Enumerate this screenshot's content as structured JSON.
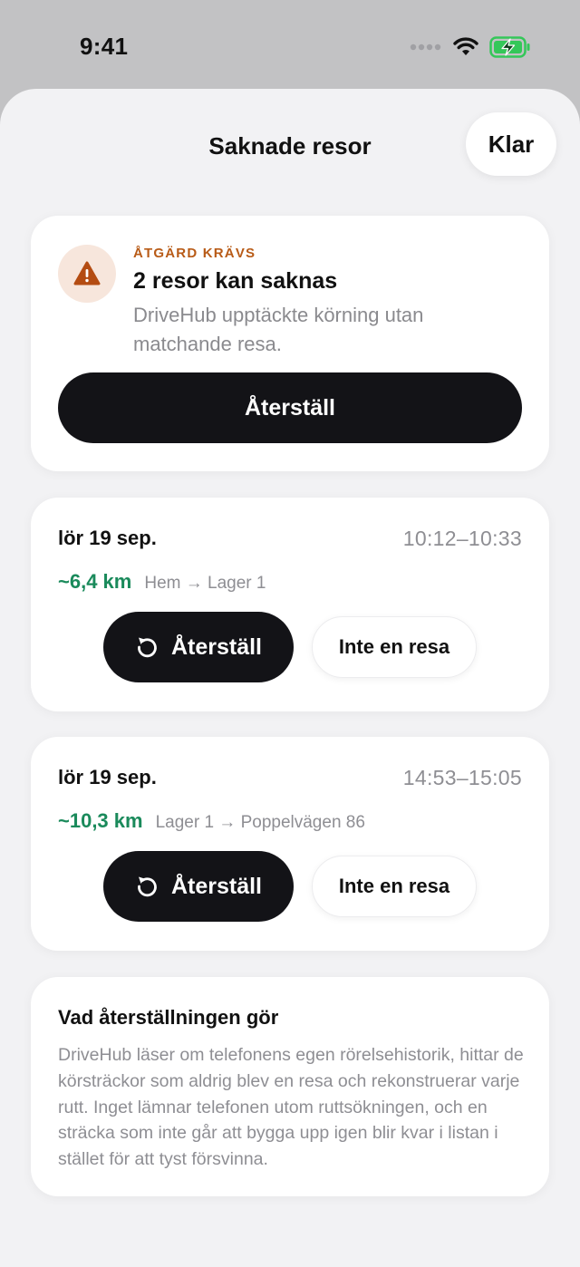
{
  "status_bar": {
    "time": "9:41"
  },
  "header": {
    "title": "Saknade resor",
    "done_label": "Klar"
  },
  "alert": {
    "kicker": "ÅTGÄRD KRÄVS",
    "title": "2 resor kan saknas",
    "description": "DriveHub upptäckte körning utan matchande resa.",
    "button_label": "Återställ",
    "icon": "warning-icon",
    "accent_color": "#b85b17"
  },
  "trips": [
    {
      "date": "lör 19 sep.",
      "time_range": "10:12–10:33",
      "distance": "~6,4 km",
      "route": "Hem → Lager 1",
      "restore_label": "Återställ",
      "dismiss_label": "Inte en resa"
    },
    {
      "date": "lör 19 sep.",
      "time_range": "14:53–15:05",
      "distance": "~10,3 km",
      "route": "Lager 1 → Poppelvägen 86",
      "restore_label": "Återställ",
      "dismiss_label": "Inte en resa"
    }
  ],
  "info": {
    "title": "Vad återställningen gör",
    "body": "DriveHub läser om telefonens egen rörelsehistorik, hittar de körsträckor som aldrig blev en resa och rekonstruerar varje rutt. Inget lämnar telefonen utom ruttsökningen, och en sträcka som inte går att bygga upp igen blir kvar i listan i stället för att tyst försvinna."
  },
  "colors": {
    "distance_green": "#1a8a5b",
    "primary_button": "#131317",
    "battery_green": "#34c759"
  }
}
